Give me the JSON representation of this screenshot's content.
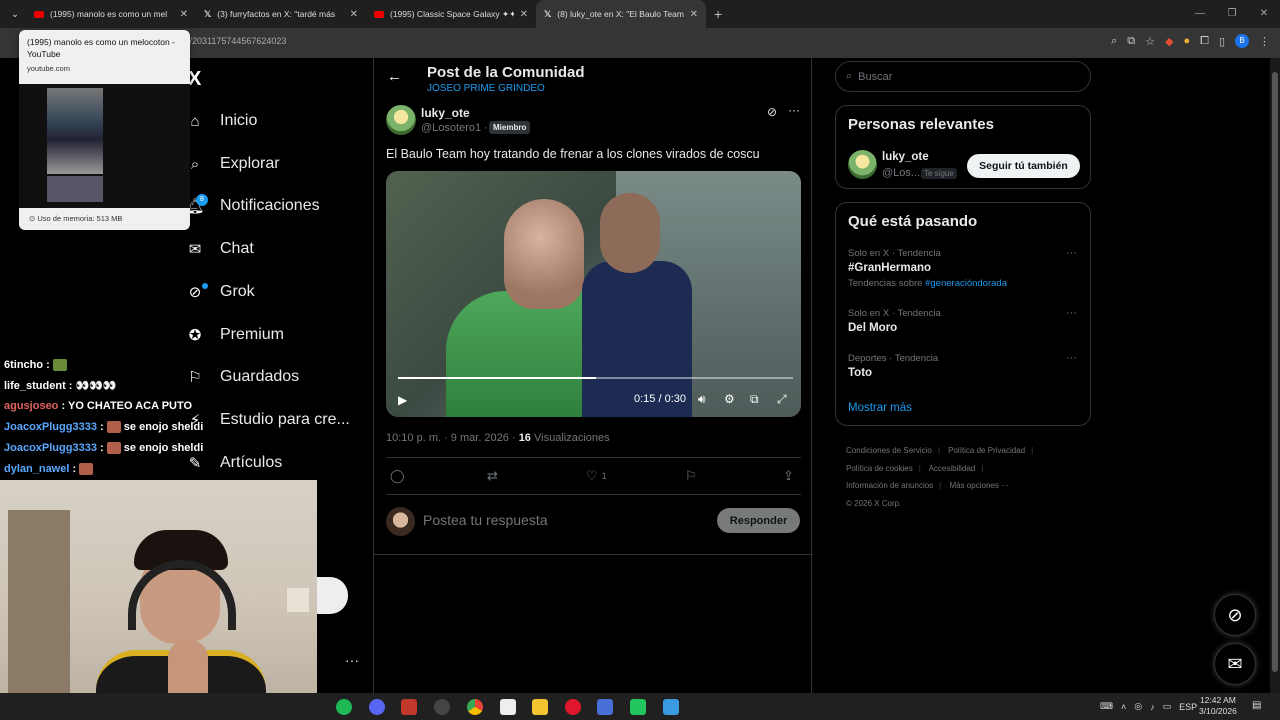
{
  "browser": {
    "tabs": [
      {
        "title": "(1995) manolo es como un mel",
        "favicon": "youtube-icon"
      },
      {
        "title": "(3) furryfactos en X: \"tardé más",
        "favicon": "x-icon"
      },
      {
        "title": "(1995) Classic Space Galaxy ✦✦",
        "favicon": "youtube-icon"
      },
      {
        "title": "(8) luky_ote en X: \"El Baulo Team",
        "favicon": "x-icon"
      }
    ],
    "new_tab": "+",
    "url": "us/2031175744567624023",
    "hovercard": {
      "title": "(1995) manolo es como un melocoton - YouTube",
      "domain": "youtube.com",
      "memory": "Uso de memoria: 513 MB"
    },
    "profile_letter": "B"
  },
  "nav": {
    "logo": "X",
    "items": [
      {
        "label": "Inicio",
        "icon": "home-icon"
      },
      {
        "label": "Explorar",
        "icon": "search-icon"
      },
      {
        "label": "Notificaciones",
        "icon": "bell-icon"
      },
      {
        "label": "Chat",
        "icon": "mail-icon"
      },
      {
        "label": "Grok",
        "icon": "grok-icon"
      },
      {
        "label": "Premium",
        "icon": "premium-icon"
      },
      {
        "label": "Guardados",
        "icon": "bookmark-icon"
      },
      {
        "label": "Estudio para cre...",
        "icon": "studio-icon"
      },
      {
        "label": "Artículos",
        "icon": "articles-icon"
      }
    ],
    "notif_count": "8",
    "more": "···"
  },
  "stream_chat": [
    {
      "user": "6tincho",
      "msg": "",
      "color": "#ffffff"
    },
    {
      "user": "life_student",
      "msg": "👀👀👀",
      "color": "#ffffff"
    },
    {
      "user": "agusjoseo",
      "msg": "YO CHATEO ACA PUTO",
      "color": "#e06060"
    },
    {
      "user": "JoacoxPlugg3333",
      "msg": "se enojo sheldi",
      "color": "#5aa8ff"
    },
    {
      "user": "JoacoxPlugg3333",
      "msg": "se enojo sheldi",
      "color": "#5aa8ff"
    },
    {
      "user": "dylan_nawel",
      "msg": "",
      "color": "#5aa8ff"
    }
  ],
  "post": {
    "header_title": "Post de la Comunidad",
    "community": "JOSEO PRIME GRINDEO",
    "author_name": "luky_ote",
    "author_handle": "@Losotero1 ·",
    "badge": "Miembro",
    "text": "El Baulo Team hoy tratando de frenar a los clones virados de coscu",
    "video": {
      "time": "0:15 / 0:30",
      "progress": 0.5
    },
    "timestamp": "10:10 p. m. · 9 mar. 2026 ·",
    "views_count": "16",
    "views_label": "Visualizaciones",
    "likes": "1",
    "reply_placeholder": "Postea tu respuesta",
    "reply_button": "Responder"
  },
  "sidebar": {
    "search_placeholder": "Buscar",
    "relevant_title": "Personas relevantes",
    "relevant": {
      "name": "luky_ote",
      "handle": "@Los...",
      "follows_you": "Te sigue",
      "follow_button": "Seguir tú también"
    },
    "trending_title": "Qué está pasando",
    "trends": [
      {
        "context": "Solo en X · Tendencia",
        "name": "#GranHermano",
        "about_prefix": "Tendencias sobre",
        "about_tag": "#generacióndorada"
      },
      {
        "context": "Solo en X · Tendencia",
        "name": "Del Moro"
      },
      {
        "context": "Deportes · Tendencia",
        "name": "Toto"
      }
    ],
    "show_more": "Mostrar más",
    "footer": [
      "Condiciones de Servicio",
      "Política de Privacidad",
      "Política de cookies",
      "Accesibilidad",
      "Información de anuncios",
      "Más opciones ···",
      "© 2026 X Corp."
    ]
  },
  "taskbar": {
    "lang": "ESP",
    "time": "12:42 AM",
    "date": "3/10/2026"
  }
}
